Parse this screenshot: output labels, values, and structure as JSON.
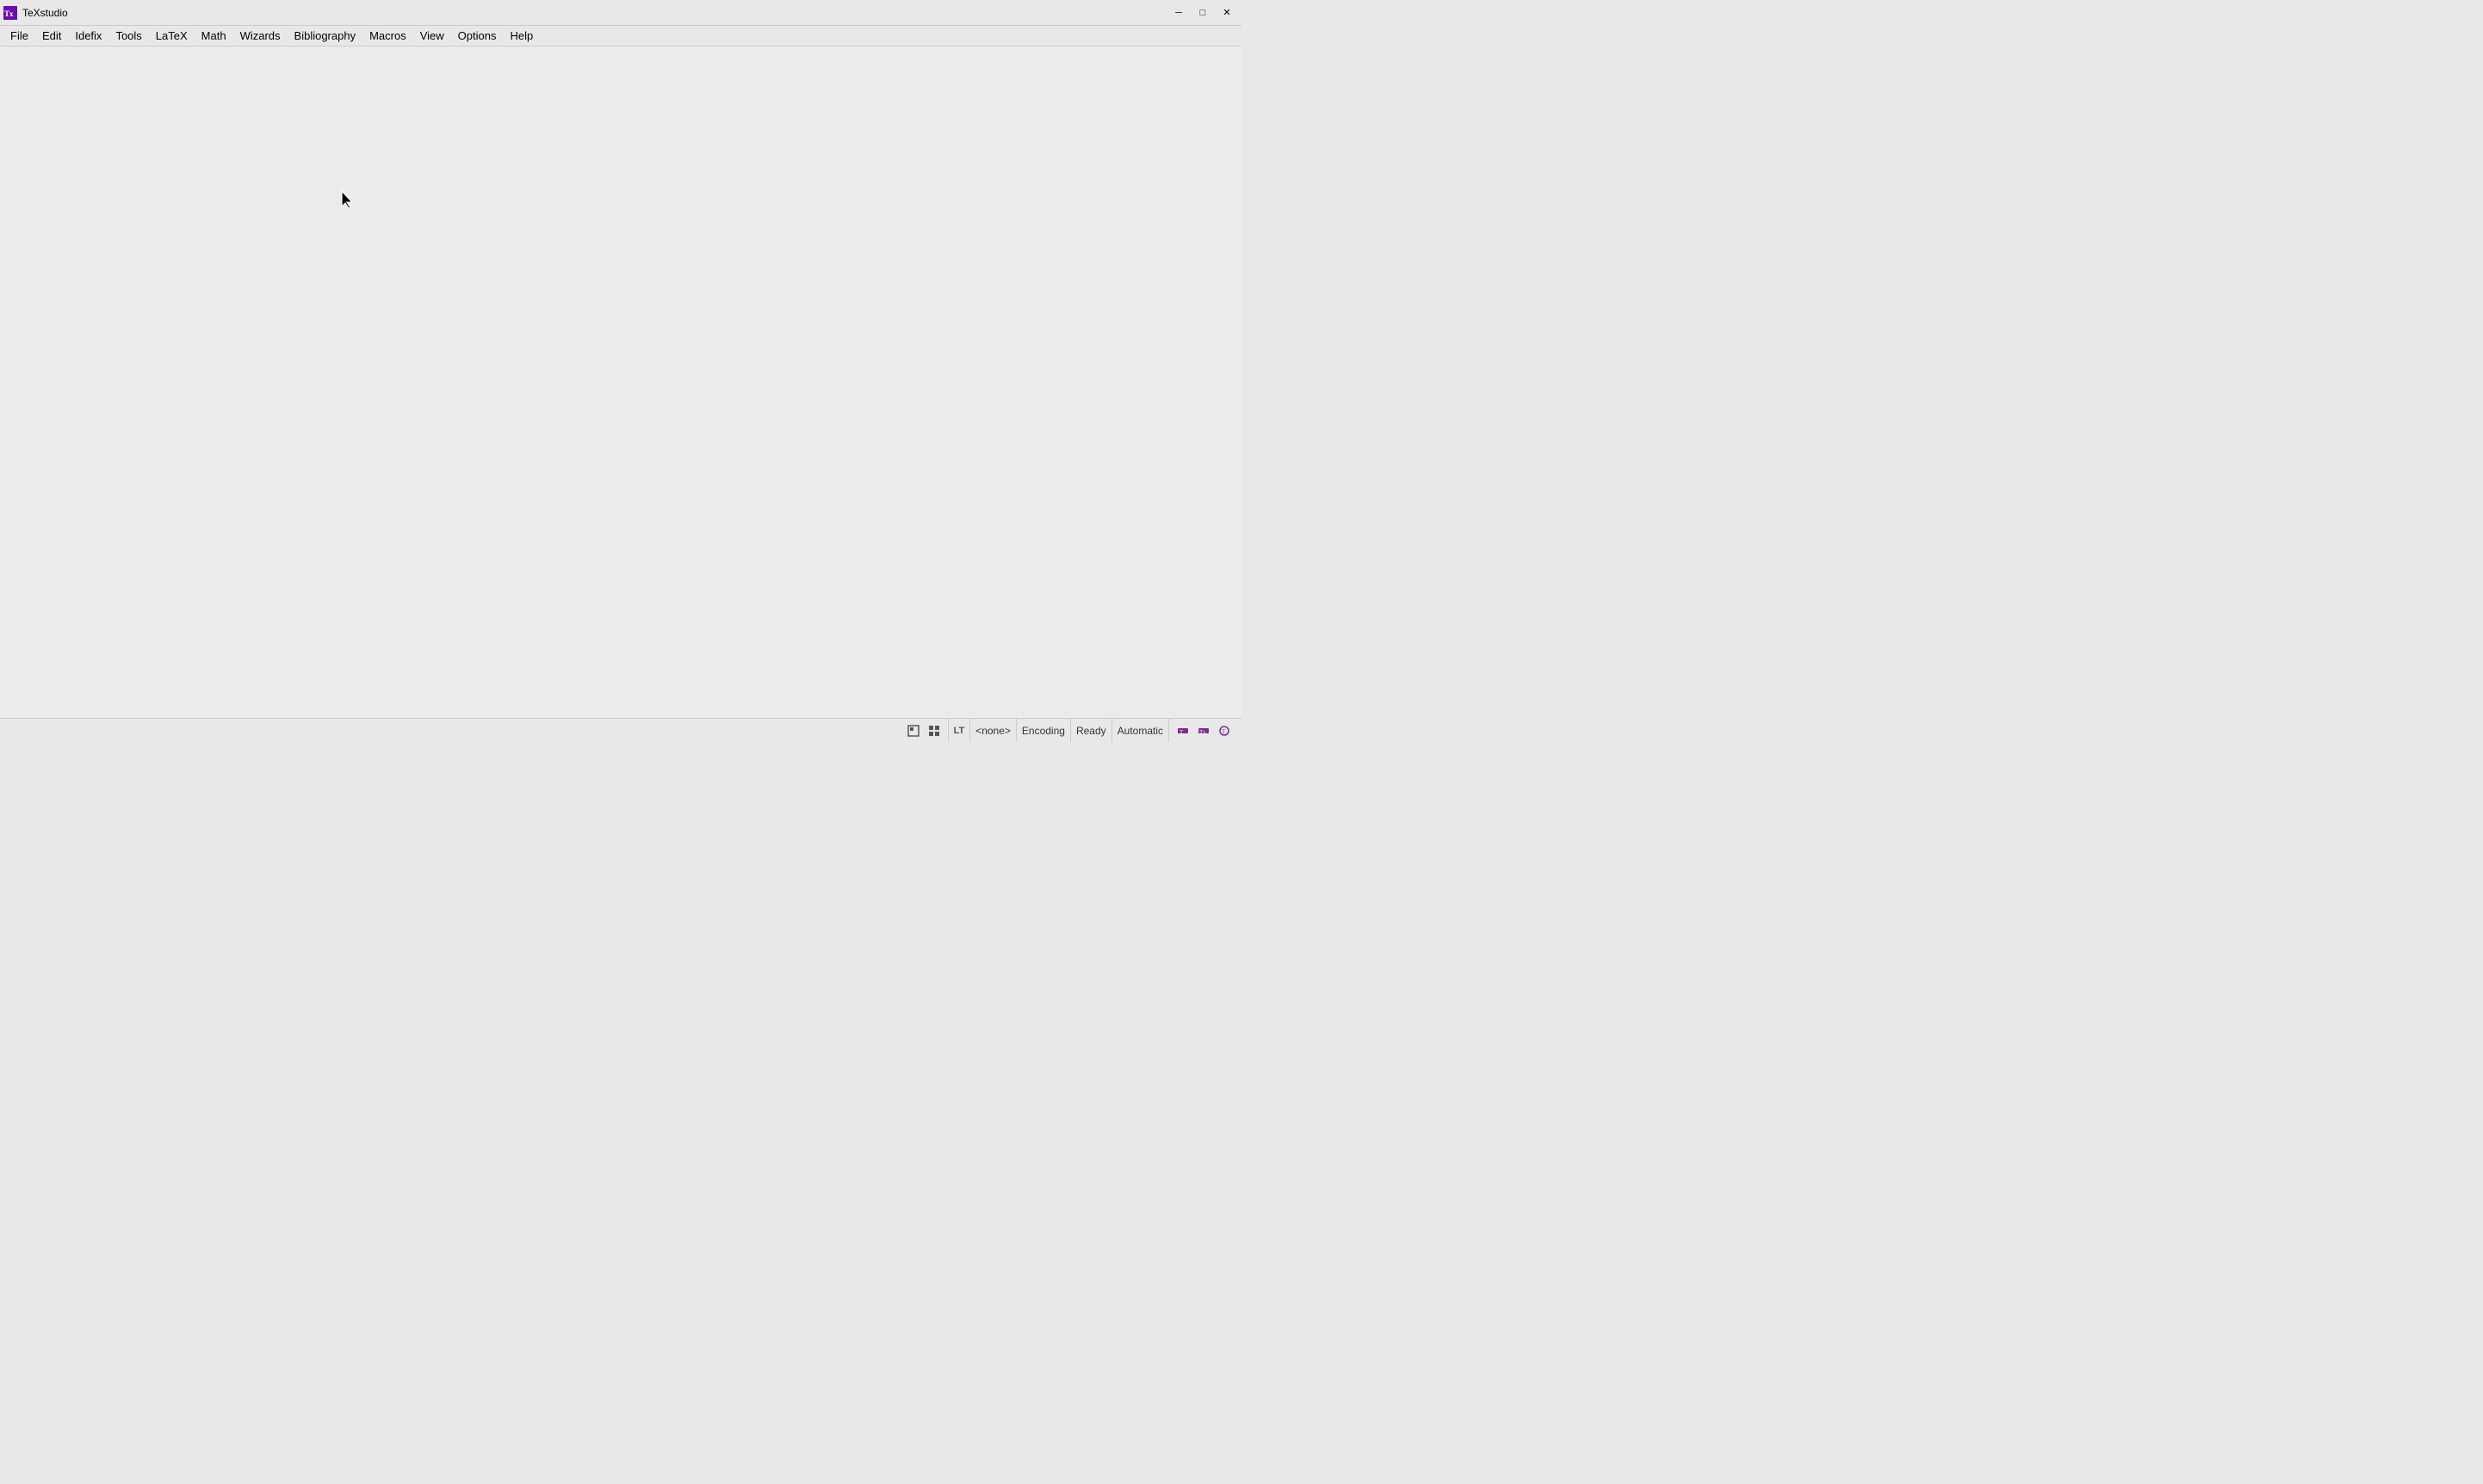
{
  "titlebar": {
    "app_name": "TeXstudio",
    "min_label": "─",
    "max_label": "□",
    "close_label": "✕"
  },
  "menubar": {
    "items": [
      {
        "id": "file",
        "label": "File"
      },
      {
        "id": "edit",
        "label": "Edit"
      },
      {
        "id": "idefix",
        "label": "Idefix"
      },
      {
        "id": "tools",
        "label": "Tools"
      },
      {
        "id": "latex",
        "label": "LaTeX"
      },
      {
        "id": "math",
        "label": "Math"
      },
      {
        "id": "wizards",
        "label": "Wizards"
      },
      {
        "id": "bibliography",
        "label": "Bibliography"
      },
      {
        "id": "macros",
        "label": "Macros"
      },
      {
        "id": "view",
        "label": "View"
      },
      {
        "id": "options",
        "label": "Options"
      },
      {
        "id": "help",
        "label": "Help"
      }
    ]
  },
  "statusbar": {
    "lt_label": "LT",
    "none_label": "<none>",
    "encoding_label": "Encoding",
    "ready_label": "Ready",
    "automatic_label": "Automatic"
  }
}
